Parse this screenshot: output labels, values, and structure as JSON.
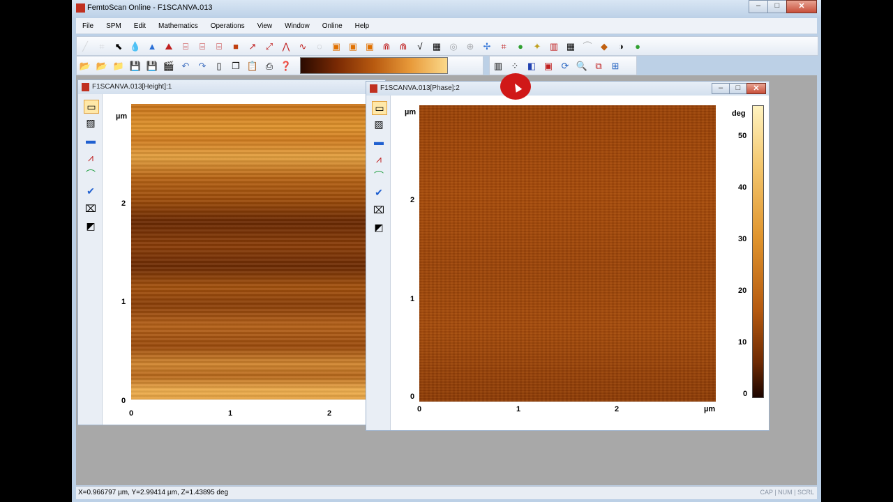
{
  "app": {
    "title": "FemtoScan Online - F1SCANVA.013",
    "min": "–",
    "max": "□",
    "close": "✕"
  },
  "menu": [
    "File",
    "SPM",
    "Edit",
    "Mathematics",
    "Operations",
    "View",
    "Window",
    "Online",
    "Help"
  ],
  "status": {
    "coords": "X=0.966797 µm, Y=2.99414 µm, Z=1.43895 deg",
    "indicators": "CAP | NUM | SCRL"
  },
  "windows": {
    "height": {
      "title": "F1SCANVA.013[Height]:1",
      "yunit": "µm",
      "yticks": [
        "2",
        "1",
        "0"
      ],
      "xticks": [
        "0",
        "1",
        "2"
      ]
    },
    "phase": {
      "title": "F1SCANVA.013[Phase]:2",
      "yunit": "µm",
      "xunit": "µm",
      "yticks": [
        "2",
        "1",
        "0"
      ],
      "xticks": [
        "0",
        "1",
        "2"
      ],
      "colorbar_unit": "deg",
      "colorbar_ticks": [
        "50",
        "40",
        "30",
        "20",
        "10",
        "0"
      ],
      "min": "–",
      "max": "□",
      "close": "✕"
    }
  },
  "icons": {
    "toolbar1": [
      "line-icon",
      "plane-icon",
      "cursor-icon",
      "drop-icon",
      "triangle-icon",
      "mountain-icon",
      "filter-icon",
      "filter2-icon",
      "filter3-icon",
      "box-icon",
      "arrow-icon",
      "zoom-icon",
      "peak-icon",
      "profile-icon",
      "corr-icon",
      "square-icon",
      "copy-icon",
      "layers-icon",
      "wave-icon",
      "wave2-icon",
      "check-icon",
      "grid-icon",
      "circle-icon",
      "target-icon",
      "grad-icon",
      "color-icon",
      "star-icon",
      "histogram-icon",
      "image-icon",
      "palette-icon",
      "drawing-icon",
      "contrast-icon",
      "grad2-icon",
      "swatch-icon"
    ],
    "toolbar2": [
      "open-icon",
      "open2-icon",
      "folder-icon",
      "save-icon",
      "saveas-icon",
      "clapper-icon",
      "undo-icon",
      "redo-icon",
      "page-icon",
      "copy-icon",
      "paste-icon",
      "print-icon",
      "help-icon"
    ],
    "toolbar3": [
      "bar-chart-icon",
      "scatter-icon",
      "cube-icon",
      "frame-icon",
      "refresh-icon",
      "magnify-icon",
      "windows-icon",
      "ruler-icon"
    ],
    "vtool": [
      "select-rect-icon",
      "image-tool-icon",
      "line-tool-icon",
      "angle-tool-icon",
      "curve-tool-icon",
      "check-tool-icon",
      "eraser-icon",
      "levels-icon"
    ]
  }
}
